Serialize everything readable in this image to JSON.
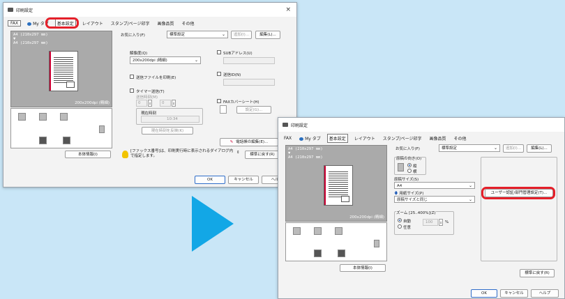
{
  "dialog1": {
    "title": "印刷設定",
    "tabs": [
      "FAX",
      "My タブ",
      "基本設定",
      "レイアウト",
      "スタンプ/ページ印字",
      "画像品質",
      "その他"
    ],
    "favorites_label": "お気に入り(F)",
    "favorites_value": "標準設定",
    "add_button": "追加(I)...",
    "edit_button": "編集(L)...",
    "preview_size_1": "A4 (210x297 mm)",
    "preview_size_2": "A4 (210x297 mm)",
    "preview_resolution": "200x200dpi (精細)",
    "resolution_label": "解像度(Q)",
    "resolution_value": "200x200dpi (精細)",
    "send_file_print": "送信ファイルを印刷(E)",
    "timer_send": "タイマー送信(T)",
    "send_time": "送信時刻(M)",
    "hour_value": "0",
    "minute_value": "0",
    "current_time_label": "現在時刻",
    "current_time_value": "10:34",
    "set_current_time": "現在時刻を反映(K)",
    "sub_address": "SUBアドレス(U)",
    "send_id": "送信ID(N)",
    "fax_cover": "FAXカバーシート(H)",
    "settings_button": "設定(G)...",
    "phonebook_button": "電話帳の編集(E)...",
    "device_info_button": "本体情報(I)",
    "hint_text": "[ファックス番号]は、印刷実行時に表示されるダイアログ内で指定します。",
    "restore_defaults": "標準に戻す(R)",
    "ok": "OK",
    "cancel": "キャンセル",
    "help": "ヘルプ"
  },
  "dialog2": {
    "title": "印刷設定",
    "tabs": [
      "FAX",
      "My タブ",
      "基本設定",
      "レイアウト",
      "スタンプ/ページ印字",
      "画像品質",
      "その他"
    ],
    "favorites_label": "お気に入り(F)",
    "favorites_value": "標準設定",
    "add_button": "追加(I)...",
    "edit_button": "編集(L)...",
    "preview_size_1": "A4 (210x297 mm)",
    "preview_size_2": "A4 (210x297 mm)",
    "preview_resolution": "200x200dpi (精細)",
    "orientation_label": "原稿の向き(O)",
    "orientation_portrait": "縦",
    "orientation_landscape": "横",
    "original_size_label": "原稿サイズ(S)",
    "original_size_value": "A4",
    "paper_size_label": "用紙サイズ(P)",
    "paper_size_value": "原稿サイズと同じ",
    "zoom_label": "ズーム [25..400%](Z)",
    "zoom_auto": "自動",
    "zoom_custom": "任意",
    "zoom_value": "100",
    "zoom_unit": "%",
    "user_auth_button": "ユーザー認証/部門管理設定(T)...",
    "device_info_button": "本体情報(I)",
    "restore_defaults": "標準に戻す(R)",
    "ok": "OK",
    "cancel": "キャンセル",
    "help": "ヘルプ"
  },
  "colors": {
    "highlight": "#e5202a",
    "arrow": "#12a7e6",
    "background": "#c9e6f7"
  }
}
